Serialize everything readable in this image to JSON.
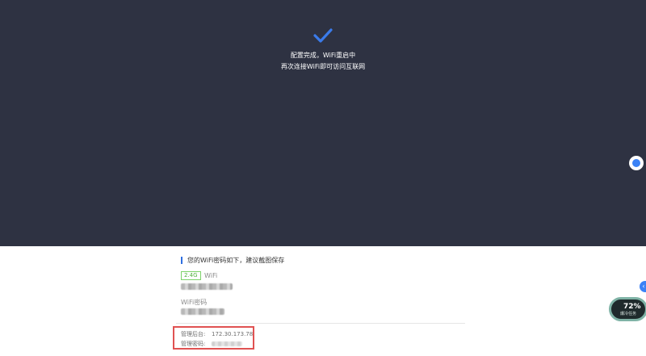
{
  "status": {
    "line1": "配置完成，WiFi重启中",
    "line2": "再次连接WiFi即可访问互联网"
  },
  "wifi_info": {
    "section_title": "您的WiFi密码如下，建议截图保存",
    "band_tag": "2.4G",
    "wifi_label": "WiFi",
    "password_label": "WiFi密码"
  },
  "admin": {
    "console_label": "管理后台:",
    "console_url": "172.30.173.78",
    "password_label": "管理密码:"
  },
  "widget": {
    "value": "72%",
    "label": "爆冷任务"
  },
  "colors": {
    "header_bg": "#2e3242",
    "accent": "#3b82f6",
    "highlight": "#e05252",
    "tag_green": "#52b23e"
  }
}
